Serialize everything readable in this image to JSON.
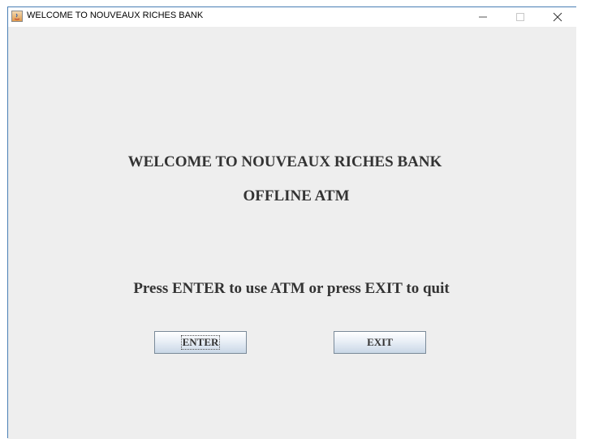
{
  "window": {
    "title": "WELCOME TO NOUVEAUX RICHES BANK"
  },
  "content": {
    "welcome_line": "WELCOME TO NOUVEAUX RICHES BANK",
    "subtitle_line": "OFFLINE ATM",
    "instruction": "Press ENTER to use ATM or press EXIT to quit"
  },
  "buttons": {
    "enter_label": "ENTER",
    "exit_label": "EXIT"
  },
  "icons": {
    "app": "java-app-icon",
    "minimize": "minimize-icon",
    "maximize": "maximize-icon",
    "close": "close-icon"
  },
  "colors": {
    "background": "#eeeeee",
    "text": "#333333",
    "window_border": "#4a7fb5"
  }
}
